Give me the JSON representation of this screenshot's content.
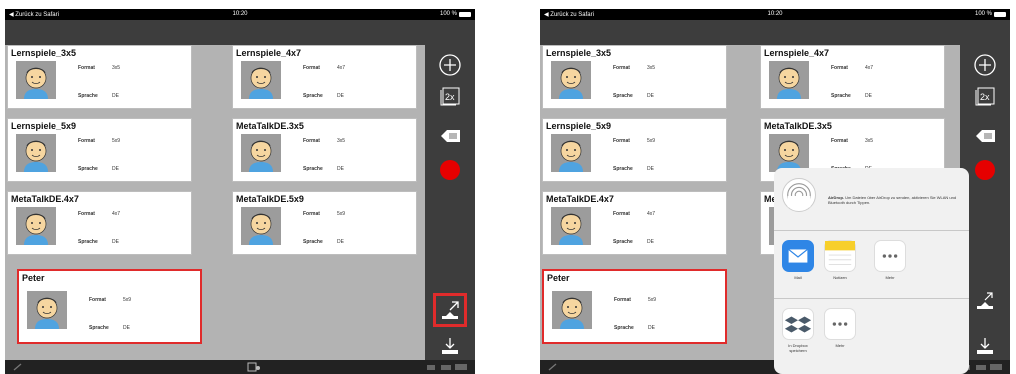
{
  "status": {
    "back": "◀ Zurück zu Safari",
    "time": "10:20",
    "battery": "100 %"
  },
  "cards": [
    {
      "title": "Lernspiele_3x5",
      "format": "3x5",
      "sprache": "DE"
    },
    {
      "title": "Lernspiele_4x7",
      "format": "4x7",
      "sprache": "DE"
    },
    {
      "title": "Lernspiele_5x9",
      "format": "5x9",
      "sprache": "DE"
    },
    {
      "title": "MetaTalkDE.3x5",
      "format": "3x5",
      "sprache": "DE"
    },
    {
      "title": "MetaTalkDE.4x7",
      "format": "4x7",
      "sprache": "DE"
    },
    {
      "title": "MetaTalkDE.5x9",
      "format": "5x9",
      "sprache": "DE"
    },
    {
      "title": "Peter",
      "format": "5x9",
      "sprache": "DE"
    }
  ],
  "labels": {
    "format": "Format",
    "sprache": "Sprache"
  },
  "toolbar": {
    "copy_label": "2x"
  },
  "share": {
    "airdrop_title": "AirDrop.",
    "airdrop_text": "Um Dateien über AirDrop zu senden, aktivieren Sie WLAN und Bluetooth durch Tippen.",
    "apps": [
      "Mail",
      "Notizen",
      "Mehr"
    ],
    "actions": [
      "In Dropbox speichern",
      "Mehr"
    ]
  },
  "colors": {
    "accent_red": "#e02b2b",
    "record_red": "#e60000",
    "mail_blue": "#2f86e6",
    "notes_yellow": "#f7cf2b"
  }
}
